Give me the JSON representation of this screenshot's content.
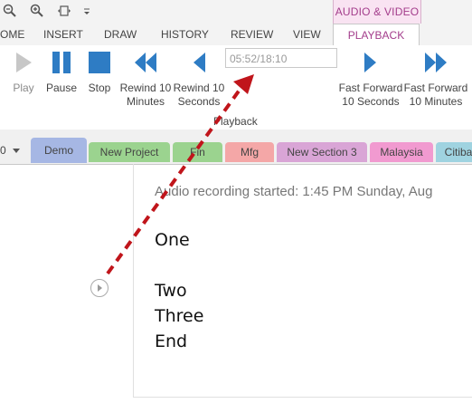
{
  "quick_access": {
    "icons": [
      "zoom-out-icon",
      "zoom-in-icon",
      "fit-page-icon",
      "customize-toolbar-icon"
    ]
  },
  "ribbon": {
    "context_group": "AUDIO & VIDEO",
    "tabs": [
      "OME",
      "INSERT",
      "DRAW",
      "HISTORY",
      "REVIEW",
      "VIEW"
    ],
    "active_tab": "PLAYBACK",
    "buttons": {
      "play": "Play",
      "pause": "Pause",
      "stop": "Stop",
      "rewind_10_min": [
        "Rewind 10",
        "Minutes"
      ],
      "rewind_10_sec": [
        "Rewind 10",
        "Seconds"
      ],
      "ff_10_sec": [
        "Fast Forward",
        "10 Seconds"
      ],
      "ff_10_min": [
        "Fast Forward",
        "10 Minutes"
      ]
    },
    "time_display": "05:52/18:10",
    "group_label": "Playback"
  },
  "sections": {
    "notebook_dropdown": "0",
    "tabs": [
      {
        "label": "Demo",
        "color": "#a6b7e4"
      },
      {
        "label": "New Project",
        "color": "#9bd38f"
      },
      {
        "label": "Fin",
        "color": "#9bd38f"
      },
      {
        "label": "Mfg",
        "color": "#f4a7a7"
      },
      {
        "label": "New Section 3",
        "color": "#d9a5d6"
      },
      {
        "label": "Malaysia",
        "color": "#f19ad0"
      },
      {
        "label": "Citiba",
        "color": "#9fd3e0"
      }
    ]
  },
  "page": {
    "recording_line": "Audio recording started: 1:45 PM Sunday, Aug",
    "lines": [
      "One",
      "Two",
      "Three",
      "End"
    ]
  },
  "colors": {
    "accent": "#a33c8b",
    "ribbon_icon": "#2e7cc4",
    "annotation_arrow": "#c0151b"
  }
}
